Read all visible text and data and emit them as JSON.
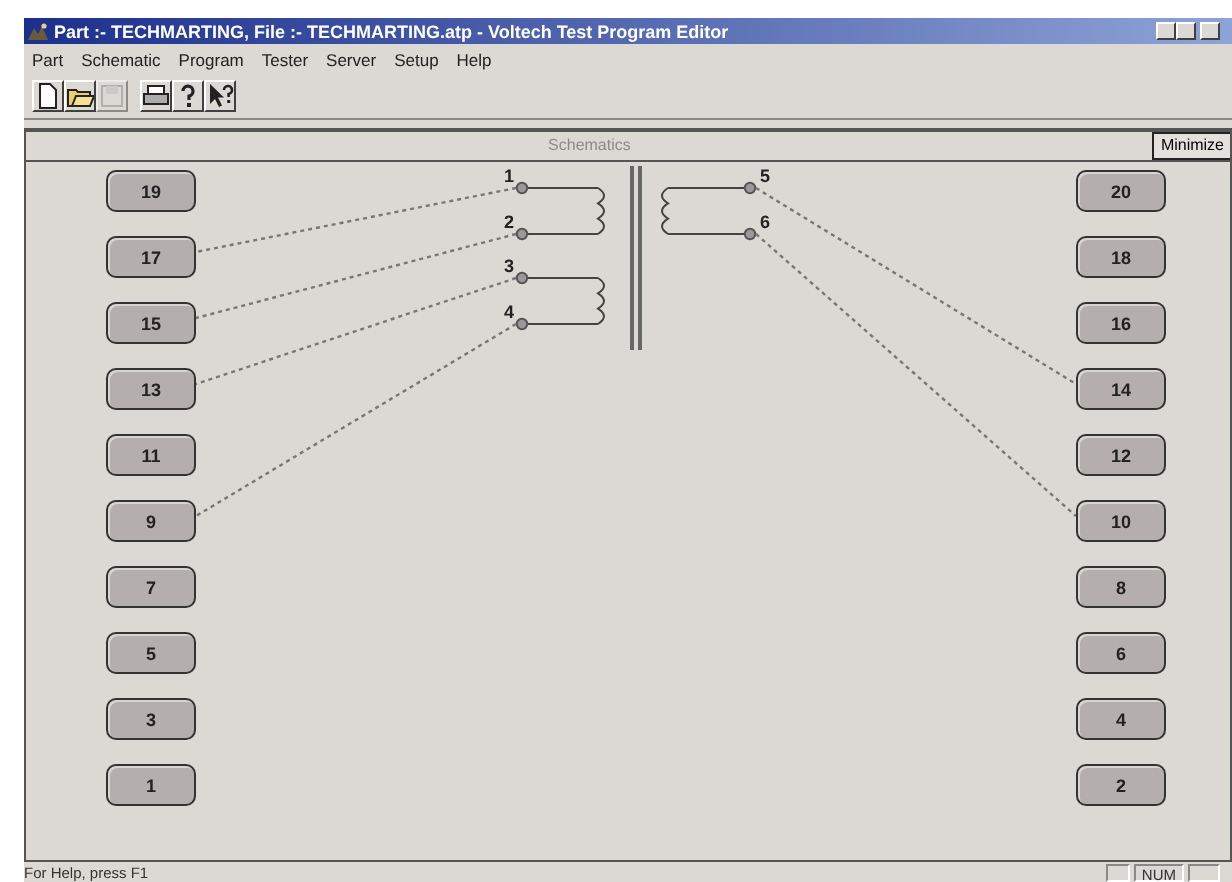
{
  "window": {
    "title": "Part :- TECHMARTING, File :- TECHMARTING.atp - Voltech Test Program Editor"
  },
  "menu": [
    "Part",
    "Schematic",
    "Program",
    "Tester",
    "Server",
    "Setup",
    "Help"
  ],
  "toolbar": [
    {
      "kind": "new",
      "disabled": false
    },
    {
      "kind": "open",
      "disabled": false
    },
    {
      "kind": "save",
      "disabled": true
    },
    {
      "kind": "separator"
    },
    {
      "kind": "print",
      "disabled": false
    },
    {
      "kind": "help",
      "disabled": false
    },
    {
      "kind": "context-help",
      "disabled": false
    }
  ],
  "schematic": {
    "title": "Schematics",
    "minimize_button": "Minimize",
    "left_pins": [
      {
        "label": "19",
        "wired": false
      },
      {
        "label": "17",
        "wired": true
      },
      {
        "label": "15",
        "wired": true
      },
      {
        "label": "13",
        "wired": true
      },
      {
        "label": "11",
        "wired": false
      },
      {
        "label": "9",
        "wired": true
      },
      {
        "label": "7",
        "wired": false
      },
      {
        "label": "5",
        "wired": false
      },
      {
        "label": "3",
        "wired": false
      },
      {
        "label": "1",
        "wired": false
      }
    ],
    "right_pins": [
      {
        "label": "20",
        "wired": false
      },
      {
        "label": "18",
        "wired": false
      },
      {
        "label": "16",
        "wired": false
      },
      {
        "label": "14",
        "wired": true
      },
      {
        "label": "12",
        "wired": false
      },
      {
        "label": "10",
        "wired": true
      },
      {
        "label": "8",
        "wired": false
      },
      {
        "label": "6",
        "wired": false
      },
      {
        "label": "4",
        "wired": false
      },
      {
        "label": "2",
        "wired": false
      }
    ],
    "primary": [
      {
        "terminals": [
          "1",
          "2"
        ]
      },
      {
        "terminals": [
          "3",
          "4"
        ]
      }
    ],
    "secondary": [
      {
        "terminals": [
          "5",
          "6"
        ]
      }
    ]
  },
  "status_bar": {
    "message": "For Help, press F1",
    "indicator": "NUM"
  }
}
